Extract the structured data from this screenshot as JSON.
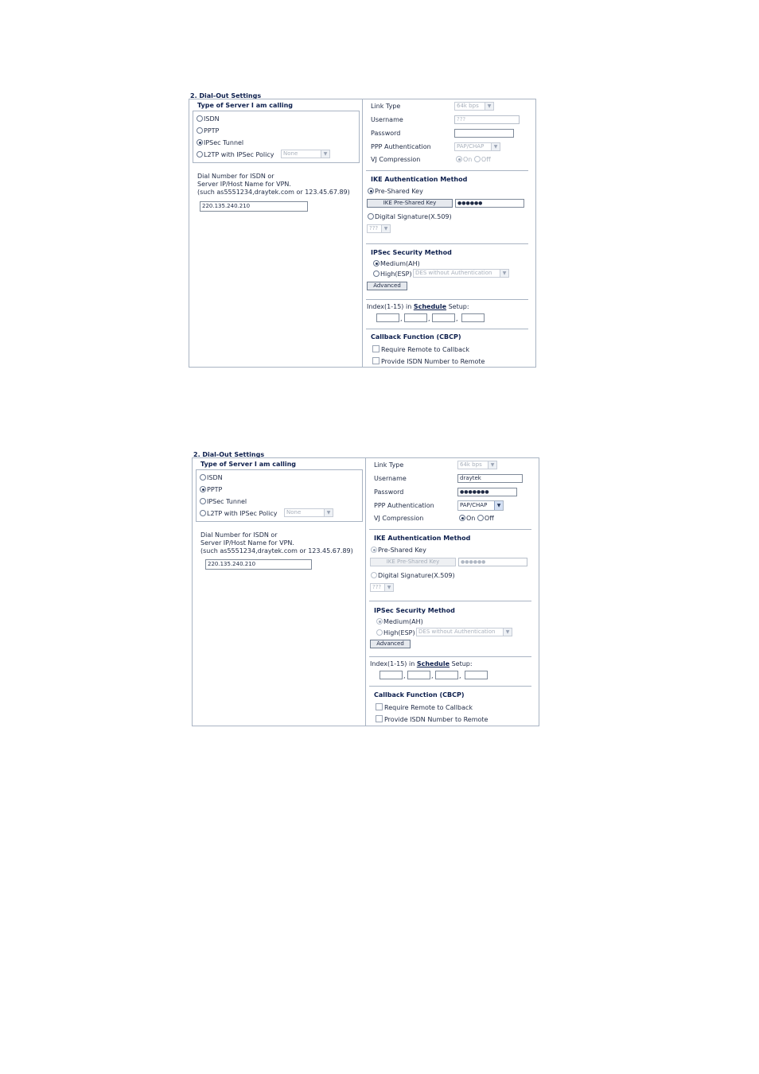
{
  "panels": [
    {
      "title": "2. Dial-Out Settings",
      "type_heading": "Type of Server I am calling",
      "server_types": [
        {
          "label": "ISDN",
          "selected": false
        },
        {
          "label": "PPTP",
          "selected": false
        },
        {
          "label": "IPSec Tunnel",
          "selected": true
        },
        {
          "label": "L2TP with IPSec Policy",
          "selected": false
        }
      ],
      "l2tp_policy_value": "None",
      "dial_label_line1": "Dial Number for ISDN or",
      "dial_label_line2": "Server IP/Host Name for VPN.",
      "dial_label_line3": "(such as5551234,draytek.com or 123.45.67.89)",
      "dial_value": "220.135.240.210",
      "link_type_label": "Link Type",
      "link_type_value": "64k bps",
      "username_label": "Username",
      "username_value": "???",
      "password_label": "Password",
      "password_value": "",
      "ppp_auth_label": "PPP Authentication",
      "ppp_auth_value": "PAP/CHAP",
      "vj_label": "VJ Compression",
      "vj_on": "On",
      "vj_off": "Off",
      "vj_selected": "On",
      "ike_heading": "IKE Authentication Method",
      "psk_label": "Pre-Shared Key",
      "psk_button": "IKE Pre-Shared Key",
      "psk_value": "●●●●●●",
      "digsig_label": "Digital Signature(X.509)",
      "digsig_value": "???",
      "ipsec_heading": "IPSec Security Method",
      "medium_label": "Medium(AH)",
      "high_label": "High(ESP)",
      "high_value": "DES without Authentication",
      "advanced_button": "Advanced",
      "index_prefix": "Index(1-15) in",
      "schedule_link": "Schedule",
      "index_suffix": "Setup:",
      "callback_heading": "Callback Function (CBCP)",
      "require_callback": "Require Remote to Callback",
      "provide_isdn": "Provide ISDN Number to Remote"
    },
    {
      "title": "2. Dial-Out Settings",
      "type_heading": "Type of Server I am calling",
      "server_types": [
        {
          "label": "ISDN",
          "selected": false
        },
        {
          "label": "PPTP",
          "selected": true
        },
        {
          "label": "IPSec Tunnel",
          "selected": false
        },
        {
          "label": "L2TP with IPSec Policy",
          "selected": false
        }
      ],
      "l2tp_policy_value": "None",
      "dial_label_line1": "Dial Number for ISDN or",
      "dial_label_line2": "Server IP/Host Name for VPN.",
      "dial_label_line3": "(such as5551234,draytek.com or 123.45.67.89)",
      "dial_value": "220.135.240.210",
      "link_type_label": "Link Type",
      "link_type_value": "64k bps",
      "username_label": "Username",
      "username_value": "draytek",
      "password_label": "Password",
      "password_value": "●●●●●●●",
      "ppp_auth_label": "PPP Authentication",
      "ppp_auth_value": "PAP/CHAP",
      "vj_label": "VJ Compression",
      "vj_on": "On",
      "vj_off": "Off",
      "vj_selected": "On",
      "ike_heading": "IKE Authentication Method",
      "psk_label": "Pre-Shared Key",
      "psk_button": "IKE Pre-Shared Key",
      "psk_value": "●●●●●●",
      "digsig_label": "Digital Signature(X.509)",
      "digsig_value": "???",
      "ipsec_heading": "IPSec Security Method",
      "medium_label": "Medium(AH)",
      "high_label": "High(ESP)",
      "high_value": "DES without Authentication",
      "advanced_button": "Advanced",
      "index_prefix": "Index(1-15) in",
      "schedule_link": "Schedule",
      "index_suffix": "Setup:",
      "callback_heading": "Callback Function (CBCP)",
      "require_callback": "Require Remote to Callback",
      "provide_isdn": "Provide ISDN Number to Remote"
    }
  ]
}
